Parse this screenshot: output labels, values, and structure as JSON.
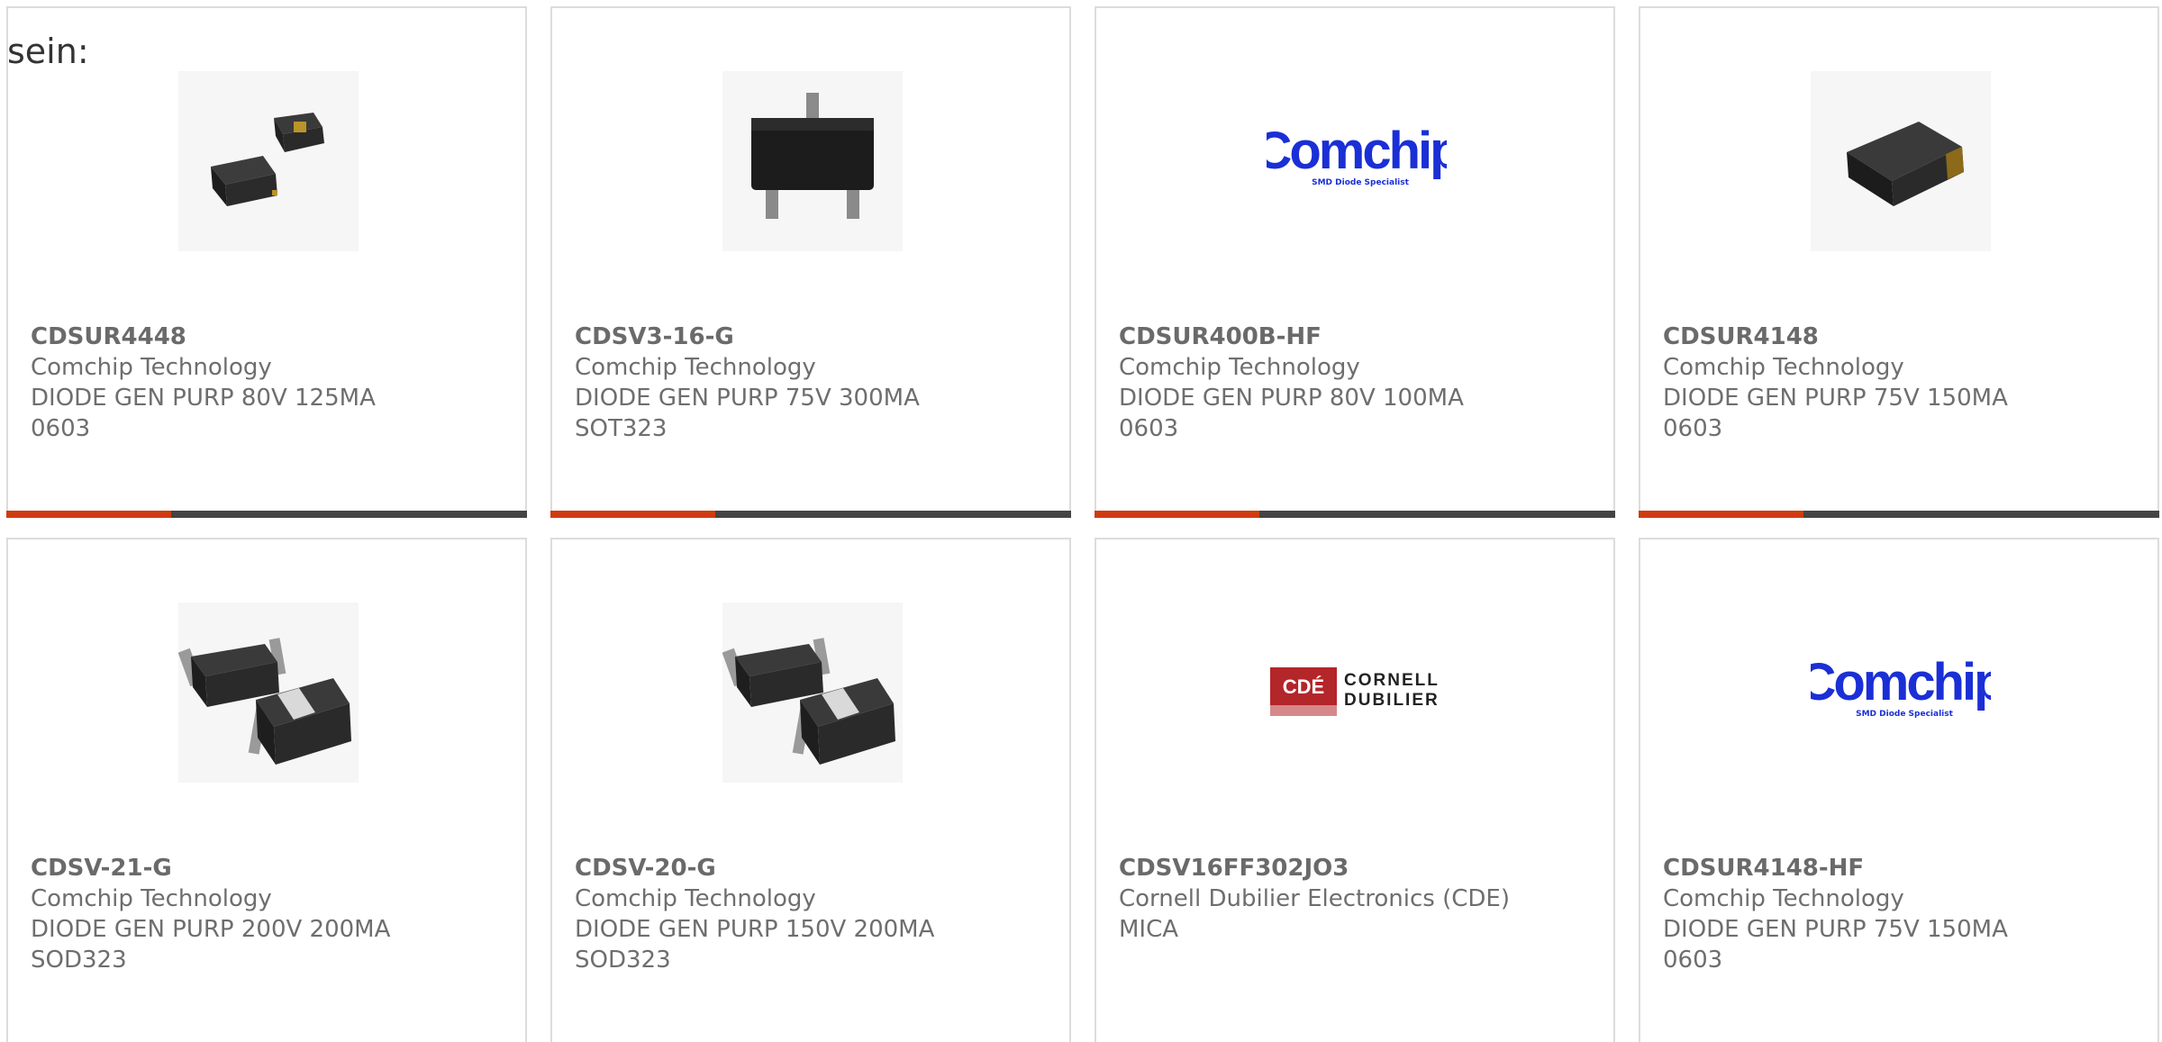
{
  "intro_text": "sein:",
  "colors": {
    "accent": "#d13b10",
    "bar_dark": "#444444",
    "border": "#dcdcdc",
    "text": "#6e6e6e",
    "comchip_blue": "#1a2fd6",
    "cde_red": "#b3262a"
  },
  "products": [
    {
      "part": "CDSUR4448",
      "maker": "Comchip Technology",
      "desc": "DIODE GEN PURP 80V 125MA",
      "package": "0603",
      "image": "two-chip-0603-icon"
    },
    {
      "part": "CDSV3-16-G",
      "maker": "Comchip Technology",
      "desc": "DIODE GEN PURP 75V 300MA",
      "package": "SOT323",
      "image": "sot323-package-icon"
    },
    {
      "part": "CDSUR400B-HF",
      "maker": "Comchip Technology",
      "desc": "DIODE GEN PURP 80V 100MA",
      "package": "0603",
      "image": "comchip-logo"
    },
    {
      "part": "CDSUR4148",
      "maker": "Comchip Technology",
      "desc": "DIODE GEN PURP 75V 150MA",
      "package": "0603",
      "image": "chip-0603-icon"
    },
    {
      "part": "CDSV-21-G",
      "maker": "Comchip Technology",
      "desc": "DIODE GEN PURP 200V 200MA",
      "package": "SOD323",
      "image": "sod323-package-icon"
    },
    {
      "part": "CDSV-20-G",
      "maker": "Comchip Technology",
      "desc": "DIODE GEN PURP 150V 200MA",
      "package": "SOD323",
      "image": "sod323-package-icon"
    },
    {
      "part": "CDSV16FF302JO3",
      "maker": "Cornell Dubilier Electronics (CDE)",
      "desc": "MICA",
      "package": "",
      "image": "cde-logo"
    },
    {
      "part": "CDSUR4148-HF",
      "maker": "Comchip Technology",
      "desc": "DIODE GEN PURP 75V 150MA",
      "package": "0603",
      "image": "comchip-logo"
    }
  ],
  "logos": {
    "comchip_word": "Comchip",
    "comchip_tagline": "SMD Diode Specialist",
    "cde_mark": "CDÉ",
    "cde_line1": "CORNELL",
    "cde_line2": "DUBILIER"
  }
}
